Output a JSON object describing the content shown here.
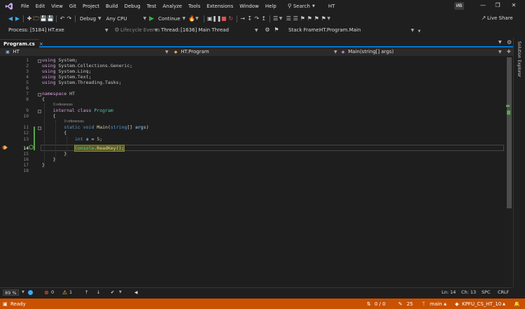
{
  "menubar": {
    "items": [
      "File",
      "Edit",
      "View",
      "Git",
      "Project",
      "Build",
      "Debug",
      "Test",
      "Analyze",
      "Tools",
      "Extensions",
      "Window",
      "Help"
    ],
    "search_label": "Search",
    "solution_name": "HT",
    "avatar_initials": "ИВ"
  },
  "toolbar": {
    "config": "Debug",
    "platform": "Any CPU",
    "continue_label": "Continue",
    "live_share": "Live Share"
  },
  "debug_location": {
    "process_label": "Process:",
    "process_value": "[5184] HT.exe",
    "lifecycle_label": "Lifecycle Events",
    "thread_label": "Thread:",
    "thread_value": "[1636] Main Thread",
    "stack_label": "Stack Frame:",
    "stack_value": "HT.Program.Main"
  },
  "tab": {
    "title": "Program.cs",
    "close": "×"
  },
  "navbar": {
    "project": "HT",
    "class": "HT.Program",
    "member": "Main(string[] args)"
  },
  "side_panel": {
    "label": "Solution Explorer"
  },
  "code": {
    "line_numbers": [
      "1",
      "2",
      "3",
      "4",
      "5",
      "6",
      "7",
      "8",
      "9",
      "10",
      "11",
      "12",
      "13",
      "14",
      "15",
      "16",
      "17",
      "18"
    ],
    "current_line": "14",
    "references": [
      "0 references",
      "0 references"
    ]
  },
  "editor_status": {
    "zoom": "89 %",
    "errors": "0",
    "warnings": "1",
    "ln": "Ln: 14",
    "ch": "Ch: 13",
    "spc": "SPC",
    "crlf": "CRLF"
  },
  "statusbar": {
    "state": "Ready",
    "changes": "0 / 0",
    "pencil_count": "25",
    "branch": "main",
    "repo": "KPFU_CS_HT_10"
  },
  "colors": {
    "status_bar": "#ca5100",
    "accent": "#0078d4",
    "changed_line": "#57a64a"
  }
}
